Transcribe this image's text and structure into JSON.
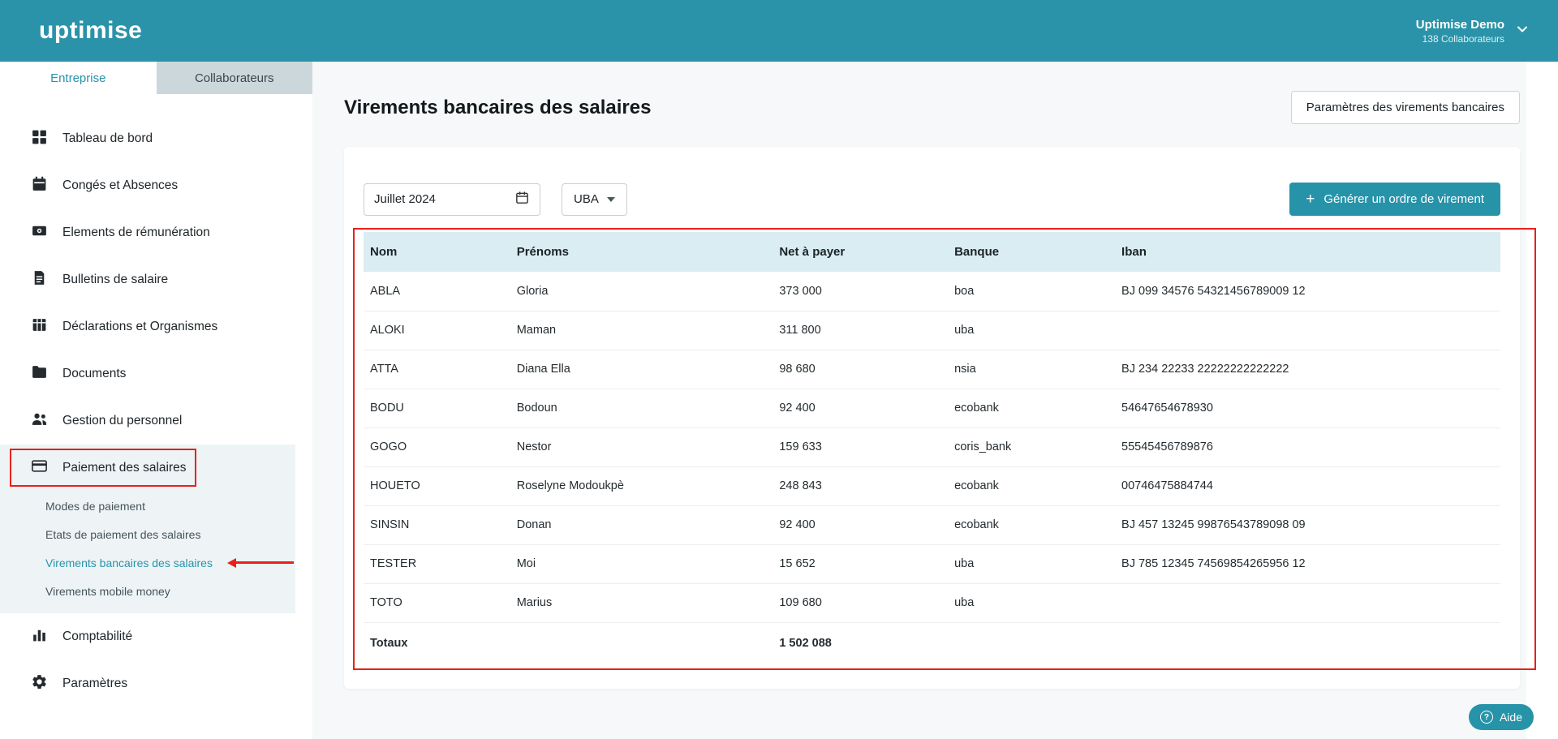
{
  "topbar": {
    "logo": "uptimise",
    "account": {
      "name": "Uptimise Demo",
      "subtitle": "138 Collaborateurs"
    }
  },
  "sidebar": {
    "tabs": [
      {
        "label": "Entreprise"
      },
      {
        "label": "Collaborateurs"
      }
    ],
    "items_top": [
      {
        "label": "Tableau de bord",
        "icon": "dashboard-icon"
      },
      {
        "label": "Congés et Absences",
        "icon": "calendar-icon"
      },
      {
        "label": "Elements de rémunération",
        "icon": "remuneration-icon"
      },
      {
        "label": "Bulletins de salaire",
        "icon": "payslip-icon"
      },
      {
        "label": "Déclarations et Organismes",
        "icon": "table-icon"
      },
      {
        "label": "Documents",
        "icon": "folder-icon"
      },
      {
        "label": "Gestion du personnel",
        "icon": "people-icon"
      }
    ],
    "payment": {
      "label": "Paiement des salaires",
      "icon": "credit-card-icon",
      "submenu": [
        {
          "label": "Modes de paiement"
        },
        {
          "label": "Etats de paiement des salaires"
        },
        {
          "label": "Virements bancaires des salaires",
          "active": true
        },
        {
          "label": "Virements mobile money"
        }
      ]
    },
    "items_bottom": [
      {
        "label": "Comptabilité",
        "icon": "bar-chart-icon"
      },
      {
        "label": "Paramètres",
        "icon": "gear-icon"
      }
    ]
  },
  "main": {
    "title": "Virements bancaires des salaires",
    "settings_button": "Paramètres des virements bancaires",
    "filters": {
      "month": "Juillet 2024",
      "bank": "UBA"
    },
    "generate_button": "Générer un ordre de virement",
    "generate_plus": "+",
    "table": {
      "headers": [
        "Nom",
        "Prénoms",
        "Net à payer",
        "Banque",
        "Iban"
      ],
      "rows": [
        [
          "ABLA",
          "Gloria",
          "373 000",
          "boa",
          "BJ 099 34576 54321456789009 12"
        ],
        [
          "ALOKI",
          "Maman",
          "311 800",
          "uba",
          ""
        ],
        [
          "ATTA",
          "Diana Ella",
          "98 680",
          "nsia",
          "BJ 234 22233 22222222222222"
        ],
        [
          "BODU",
          "Bodoun",
          "92 400",
          "ecobank",
          "54647654678930"
        ],
        [
          "GOGO",
          "Nestor",
          "159 633",
          "coris_bank",
          "55545456789876"
        ],
        [
          "HOUETO",
          "Roselyne Modoukpè",
          "248 843",
          "ecobank",
          "00746475884744"
        ],
        [
          "SINSIN",
          "Donan",
          "92 400",
          "ecobank",
          "BJ 457 13245 99876543789098 09"
        ],
        [
          "TESTER",
          "Moi",
          "15 652",
          "uba",
          "BJ 785 12345 74569854265956 12"
        ],
        [
          "TOTO",
          "Marius",
          "109 680",
          "uba",
          ""
        ]
      ],
      "totals": {
        "label": "Totaux",
        "net": "1 502 088"
      }
    }
  },
  "help": {
    "label": "Aide",
    "glyph": "?"
  },
  "colors": {
    "topbar_teal": "#2a93a9",
    "accent_teal": "#2793a9",
    "table_header_bg": "#d9edf3",
    "annotation_red": "#e8201a",
    "sidebar_active_bg": "#eef4f6",
    "inactive_tab_bg": "#ccd7db",
    "content_bg": "#f6f8f9"
  }
}
